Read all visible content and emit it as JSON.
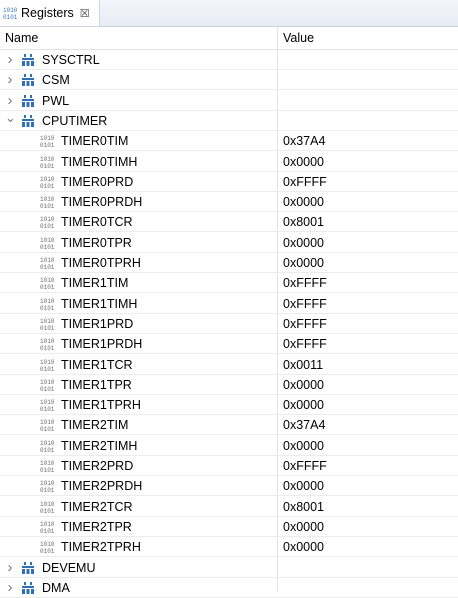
{
  "tab": {
    "title": "Registers",
    "close_glyph": "☒"
  },
  "columns": {
    "name": "Name",
    "value": "Value"
  },
  "groups_top": [
    {
      "label": "SYSCTRL",
      "expanded": false
    },
    {
      "label": "CSM",
      "expanded": false
    },
    {
      "label": "PWL",
      "expanded": false
    }
  ],
  "cputimer": {
    "label": "CPUTIMER",
    "expanded": true,
    "registers": [
      {
        "name": "TIMER0TIM",
        "value": "0x37A4"
      },
      {
        "name": "TIMER0TIMH",
        "value": "0x0000"
      },
      {
        "name": "TIMER0PRD",
        "value": "0xFFFF"
      },
      {
        "name": "TIMER0PRDH",
        "value": "0x0000"
      },
      {
        "name": "TIMER0TCR",
        "value": "0x8001"
      },
      {
        "name": "TIMER0TPR",
        "value": "0x0000"
      },
      {
        "name": "TIMER0TPRH",
        "value": "0x0000"
      },
      {
        "name": "TIMER1TIM",
        "value": "0xFFFF"
      },
      {
        "name": "TIMER1TIMH",
        "value": "0xFFFF"
      },
      {
        "name": "TIMER1PRD",
        "value": "0xFFFF"
      },
      {
        "name": "TIMER1PRDH",
        "value": "0xFFFF"
      },
      {
        "name": "TIMER1TCR",
        "value": "0x0011"
      },
      {
        "name": "TIMER1TPR",
        "value": "0x0000"
      },
      {
        "name": "TIMER1TPRH",
        "value": "0x0000"
      },
      {
        "name": "TIMER2TIM",
        "value": "0x37A4"
      },
      {
        "name": "TIMER2TIMH",
        "value": "0x0000"
      },
      {
        "name": "TIMER2PRD",
        "value": "0xFFFF"
      },
      {
        "name": "TIMER2PRDH",
        "value": "0x0000"
      },
      {
        "name": "TIMER2TCR",
        "value": "0x8001"
      },
      {
        "name": "TIMER2TPR",
        "value": "0x0000"
      },
      {
        "name": "TIMER2TPRH",
        "value": "0x0000"
      }
    ]
  },
  "groups_bottom": [
    {
      "label": "DEVEMU",
      "expanded": false
    },
    {
      "label": "DMA",
      "expanded": false
    }
  ],
  "icons": {
    "tab": "register-view-icon",
    "group": "register-group-icon",
    "register": "register-icon",
    "collapsed": "chevron-right-icon",
    "expanded": "chevron-down-icon"
  },
  "colors": {
    "group_icon": "#2f6fb3",
    "tab_accent": "#3b7cc6",
    "register_icon": "#6e6e6e"
  }
}
